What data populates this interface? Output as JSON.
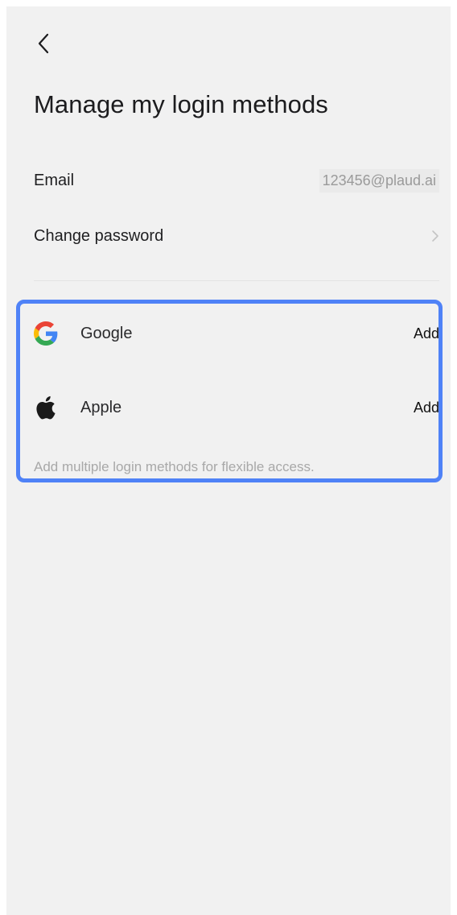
{
  "header": {
    "title": "Manage my login methods"
  },
  "account": {
    "email_label": "Email",
    "email_value": "123456@plaud.ai",
    "change_password_label": "Change password"
  },
  "providers": [
    {
      "name": "Google",
      "icon": "google-icon",
      "action": "Add"
    },
    {
      "name": "Apple",
      "icon": "apple-icon",
      "action": "Add"
    }
  ],
  "hint": "Add multiple login methods for flexible access.",
  "colors": {
    "background": "#f1f1f1",
    "highlight": "#4f82f7",
    "secondary_text": "#a8a8a8"
  }
}
